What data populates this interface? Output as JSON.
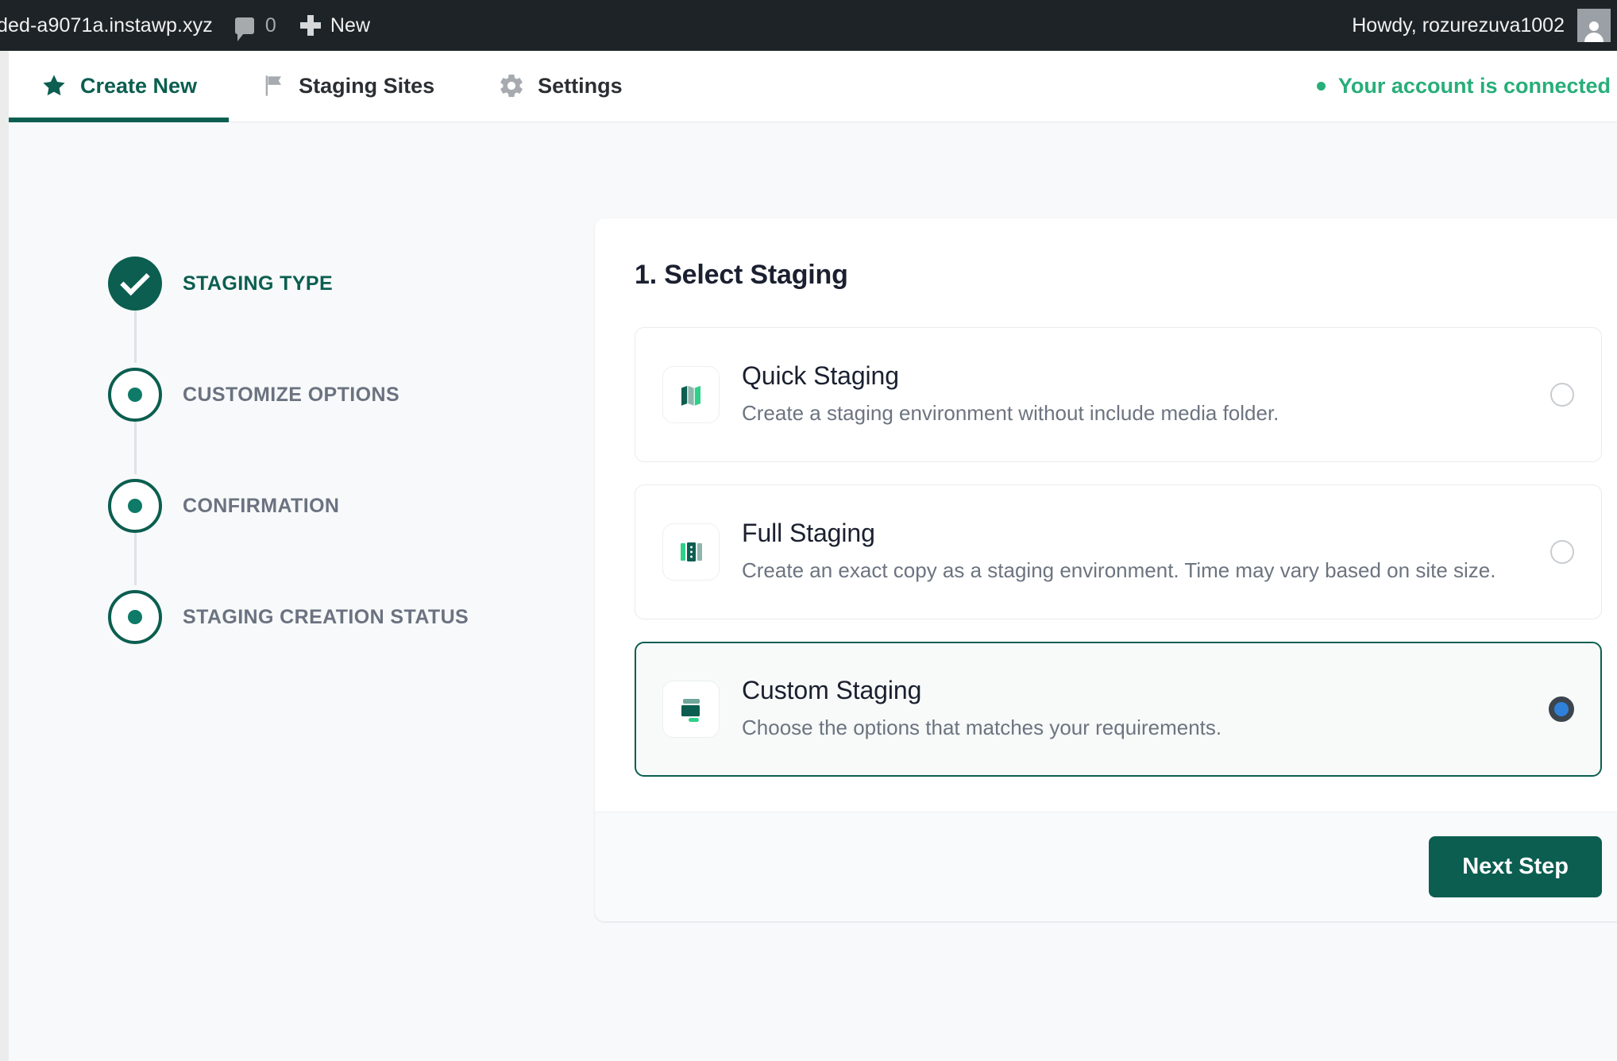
{
  "adminbar": {
    "site_name": "ded-a9071a.instawp.xyz",
    "comment_count": "0",
    "new_label": "New",
    "howdy": "Howdy, rozurezuva1002"
  },
  "tabbar": {
    "tabs": [
      {
        "label": "Create New",
        "icon": "star-icon",
        "active": true
      },
      {
        "label": "Staging Sites",
        "icon": "flag-icon",
        "active": false
      },
      {
        "label": "Settings",
        "icon": "gear-icon",
        "active": false
      }
    ],
    "connection": {
      "text": "Your account is connected",
      "color": "#27ae79"
    }
  },
  "stepper": {
    "steps": [
      {
        "label": "Staging Type",
        "state": "done",
        "active": true
      },
      {
        "label": "Customize Options",
        "state": "pending",
        "active": false
      },
      {
        "label": "Confirmation",
        "state": "pending",
        "active": false
      },
      {
        "label": "Staging Creation Status",
        "state": "pending",
        "active": false
      }
    ]
  },
  "card": {
    "title": "1. Select Staging",
    "options": [
      {
        "title": "Quick Staging",
        "desc": "Create a staging environment without include media folder.",
        "icon": "map-panels-icon",
        "selected": false
      },
      {
        "title": "Full Staging",
        "desc": "Create an exact copy as a staging environment. Time may vary based on site size.",
        "icon": "columns-icon",
        "selected": false
      },
      {
        "title": "Custom Staging",
        "desc": "Choose the options that matches your requirements.",
        "icon": "layout-blocks-icon",
        "selected": true
      }
    ],
    "next_label": "Next Step"
  },
  "colors": {
    "brand_green": "#0b5e50",
    "accent_green": "#27ae79",
    "radio_blue": "#2f80d8",
    "page_bg": "#f7f9fa",
    "adminbar_bg": "#1d2327"
  }
}
